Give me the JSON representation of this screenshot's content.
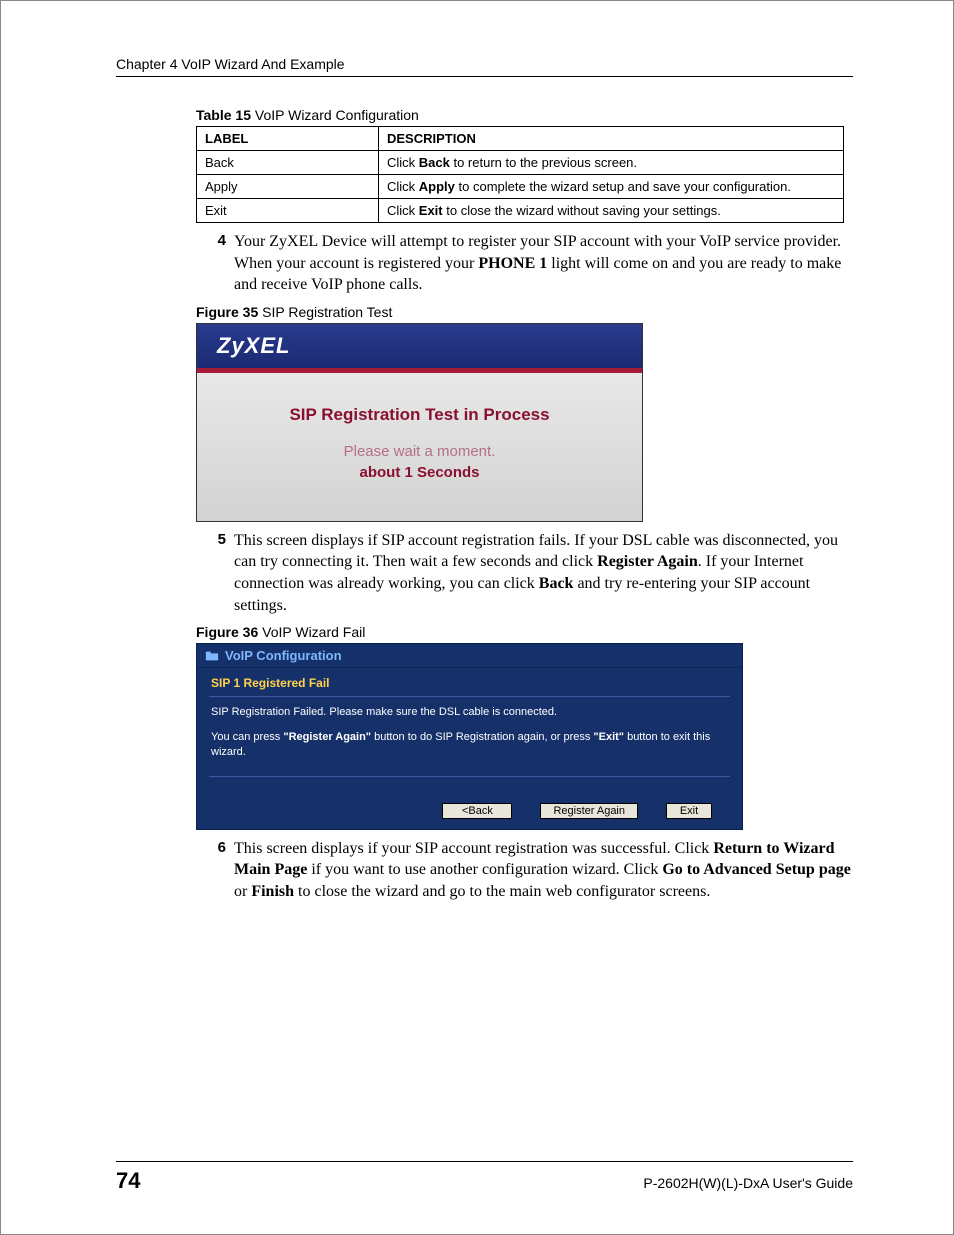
{
  "header": {
    "chapter": "Chapter 4 VoIP Wizard And Example"
  },
  "table15": {
    "caption_bold": "Table 15",
    "caption_rest": "   VoIP Wizard Configuration",
    "headers": {
      "label": "LABEL",
      "description": "DESCRIPTION"
    },
    "rows": [
      {
        "label": "Back",
        "desc_pre": "Click ",
        "desc_bold": "Back",
        "desc_post": " to return to the previous screen."
      },
      {
        "label": "Apply",
        "desc_pre": "Click ",
        "desc_bold": "Apply",
        "desc_post": " to complete the wizard setup and save your configuration."
      },
      {
        "label": "Exit",
        "desc_pre": "Click ",
        "desc_bold": "Exit",
        "desc_post": " to close the wizard without saving your settings."
      }
    ]
  },
  "step4": {
    "num": "4",
    "l1": "Your ZyXEL Device will attempt to register your SIP account with your VoIP service provider. When your account is registered your ",
    "b1": "PHONE 1",
    "l2": " light will come on and you are ready to make and receive VoIP phone calls."
  },
  "fig35": {
    "caption_bold": "Figure 35",
    "caption_rest": "   SIP Registration Test",
    "brand": "ZyXEL",
    "line1": "SIP Registration Test in Process",
    "line2": "Please wait a moment.",
    "line3": "about 1 Seconds"
  },
  "step5": {
    "num": "5",
    "l1": "This screen displays if SIP account registration fails. If your DSL cable was disconnected, you can try connecting it. Then wait a few seconds and click ",
    "b1": "Register Again",
    "l2": ". If your Internet connection was already working, you can click ",
    "b2": "Back",
    "l3": " and try re-entering your SIP account settings."
  },
  "fig36": {
    "caption_bold": "Figure 36",
    "caption_rest": "   VoIP Wizard Fail",
    "title": "VoIP Configuration",
    "sub": "SIP 1 Registered Fail",
    "msg1": "SIP Registration Failed. Please make sure the DSL cable is connected.",
    "msg2_a": "You can press ",
    "msg2_b1": "\"Register Again\"",
    "msg2_b": " button to do SIP Registration again, or press ",
    "msg2_b2": "\"Exit\"",
    "msg2_c": " button to exit this wizard.",
    "buttons": {
      "back": "<Back",
      "again": "Register Again",
      "exit": "Exit"
    }
  },
  "step6": {
    "num": "6",
    "l1": "This screen displays if your SIP account registration was successful. Click ",
    "b1": "Return to Wizard Main Page",
    "l2": " if you want to use another configuration wizard. Click ",
    "b2": "Go to Advanced Setup page",
    "l3": " or ",
    "b3": "Finish",
    "l4": " to close the wizard and go to the main web configurator screens."
  },
  "footer": {
    "pageno": "74",
    "guide": "P-2602H(W)(L)-DxA User's Guide"
  }
}
